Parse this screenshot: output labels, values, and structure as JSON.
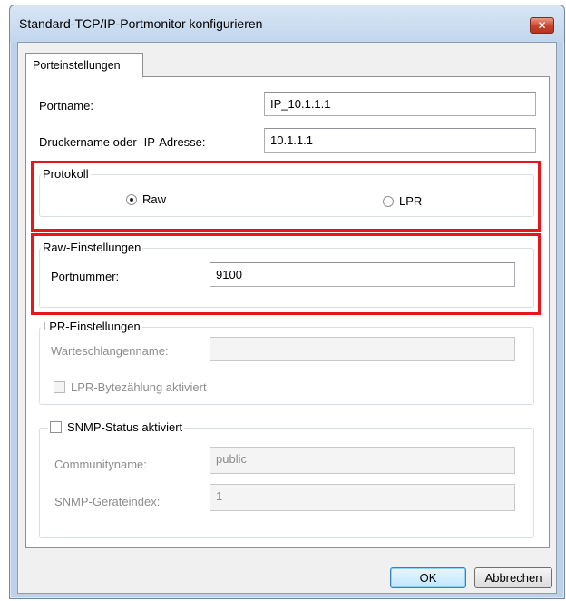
{
  "window": {
    "title": "Standard-TCP/IP-Portmonitor konfigurieren",
    "close_symbol": "✕"
  },
  "tabs": [
    {
      "label": "Porteinstellungen",
      "active": true
    }
  ],
  "port": {
    "name_label": "Portname:",
    "name_value": "IP_10.1.1.1",
    "address_label": "Druckername oder -IP-Adresse:",
    "address_value": "10.1.1.1"
  },
  "protocol": {
    "caption": "Protokoll",
    "options": [
      {
        "label": "Raw",
        "selected": true
      },
      {
        "label": "LPR",
        "selected": false
      }
    ]
  },
  "raw_settings": {
    "caption": "Raw-Einstellungen",
    "port_number_label": "Portnummer:",
    "port_number_value": "9100"
  },
  "lpr_settings": {
    "caption": "LPR-Einstellungen",
    "queue_label": "Warteschlangenname:",
    "queue_value": "",
    "byte_count_label": "LPR-Bytezählung aktiviert",
    "byte_count_checked": false
  },
  "snmp": {
    "caption": "SNMP-Status aktiviert",
    "enabled": false,
    "community_label": "Communityname:",
    "community_value": "public",
    "device_index_label": "SNMP-Geräteindex:",
    "device_index_value": "1"
  },
  "buttons": {
    "ok": "OK",
    "cancel": "Abbrechen"
  },
  "colors": {
    "highlight": "#e8151b",
    "title_bar": "#c2d6ec",
    "close_button": "#c7422b"
  }
}
